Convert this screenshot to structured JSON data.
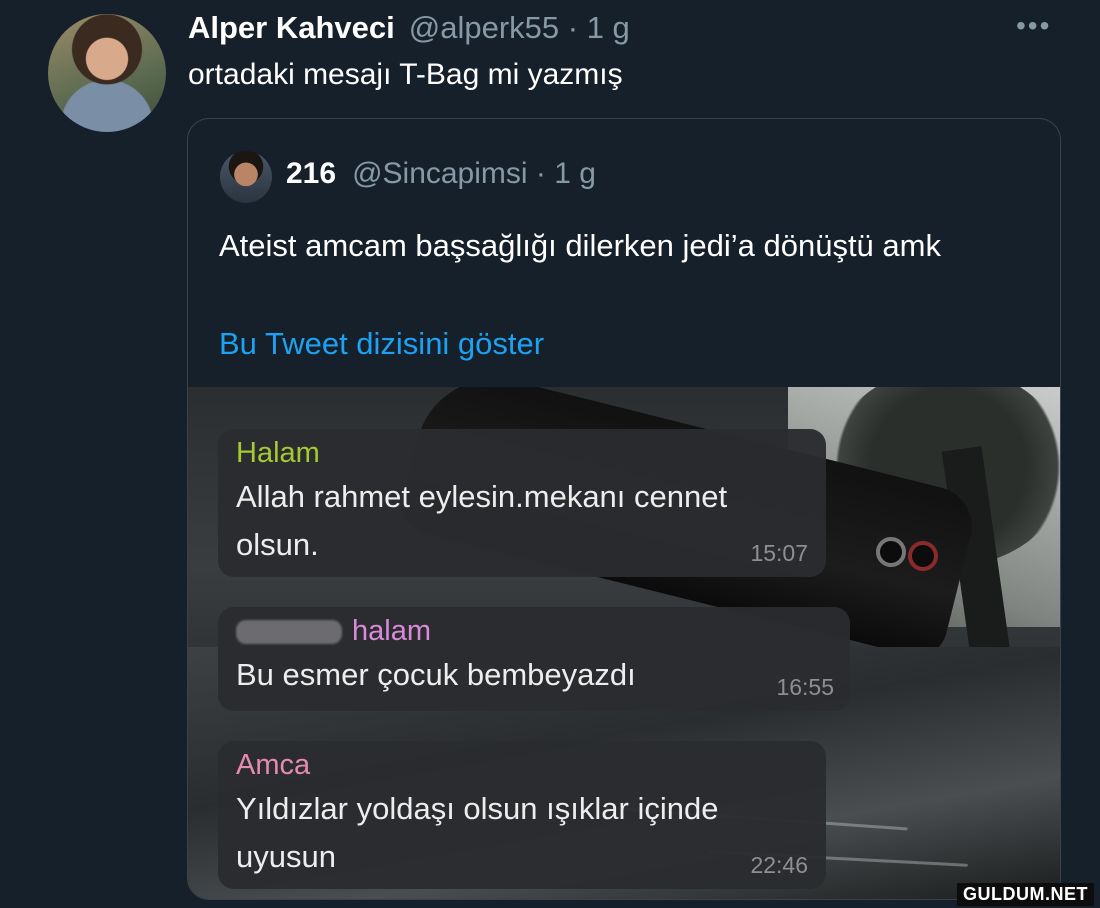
{
  "tweet": {
    "author_name": "Alper Kahveci",
    "author_handle": "@alperk55 · 1 g",
    "text": "ortadaki mesajı T-Bag mi yazmış",
    "more_icon": "•••"
  },
  "quoted": {
    "author_name": "216",
    "author_handle": "@Sincapimsi · 1 g",
    "text": "Ateist amcam başsağlığı dilerken jedi’a dönüştü amk",
    "thread_link": "Bu Tweet dizisini göster"
  },
  "chat": {
    "messages": [
      {
        "sender": "Halam",
        "sender_color": "#a6c832",
        "text": "Allah rahmet eylesin.mekanı cennet olsun.",
        "time": "15:07"
      },
      {
        "sender": "halam",
        "sender_color": "#d98ad8",
        "text": "Bu esmer çocuk bembeyazdı",
        "time": "16:55"
      },
      {
        "sender": "Amca",
        "sender_color": "#e58ab0",
        "text": "Yıldızlar yoldaşı olsun ışıklar içinde uyusun",
        "time": "22:46"
      }
    ]
  },
  "watermark": "GULDUM.NET",
  "colors": {
    "background": "#15202b",
    "link": "#1da1f2",
    "muted": "#8899a6",
    "border": "#38444d"
  }
}
